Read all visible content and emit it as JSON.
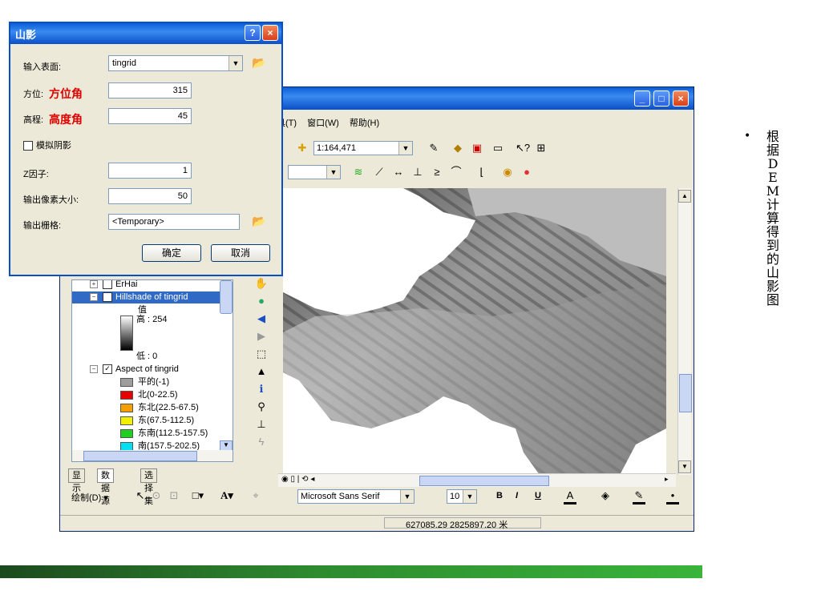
{
  "dialog": {
    "title": "山影",
    "help_btn": "?",
    "close_btn": "×",
    "input_surface_label": "输入表面:",
    "input_surface_value": "tingrid",
    "azimuth_label": "方位:",
    "azimuth_annot": "方位角",
    "azimuth_value": "315",
    "altitude_label": "高程:",
    "altitude_annot": "高度角",
    "altitude_value": "45",
    "shadow_label": "模拟阴影",
    "zfactor_label": "Z因子:",
    "zfactor_value": "1",
    "cellsize_label": "输出像素大小:",
    "cellsize_value": "50",
    "output_label": "输出栅格:",
    "output_value": "<Temporary>",
    "ok_label": "确定",
    "cancel_label": "取消"
  },
  "menu": {
    "tools": "具(T)",
    "window": "窗口(W)",
    "help": "帮助(H)"
  },
  "toolbar": {
    "scale_value": "1:164,471"
  },
  "toc": {
    "layers": [
      {
        "name": "ErHai"
      },
      {
        "name": "Hillshade of tingrid"
      }
    ],
    "value_label": "值",
    "high_label": "高 : 254",
    "low_label": "低 : 0",
    "aspect_layer": "Aspect of tingrid",
    "aspect_classes": [
      {
        "label": "平的(-1)",
        "color": "#9e9e9e"
      },
      {
        "label": "北(0-22.5)",
        "color": "#e80000"
      },
      {
        "label": "东北(22.5-67.5)",
        "color": "#f5a000"
      },
      {
        "label": "东(67.5-112.5)",
        "color": "#f0f000"
      },
      {
        "label": "东南(112.5-157.5)",
        "color": "#20d020"
      },
      {
        "label": "南(157.5-202.5)",
        "color": "#00e0f0"
      }
    ]
  },
  "tabs": {
    "display": "显示",
    "source": "数据源",
    "selection": "选择集"
  },
  "drawbar": {
    "draw_label": "绘制(D) ▾",
    "font_value": "Microsoft Sans Serif",
    "size_value": "10",
    "bold": "B",
    "italic": "I",
    "underline": "U"
  },
  "status": {
    "coords": "627085.29  2825897.20 米"
  },
  "slide": {
    "bullet": "根据DEM计算得到的山影图"
  }
}
